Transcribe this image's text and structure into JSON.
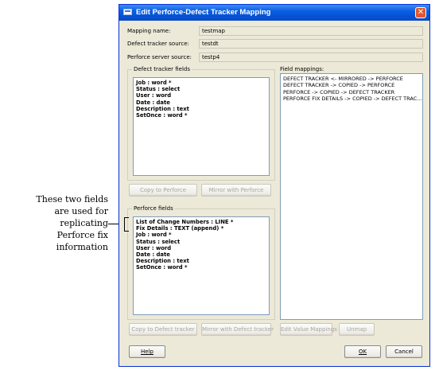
{
  "annotation": {
    "lines": [
      "These two fields",
      "are used for",
      "replicating",
      "Perforce fix",
      "information"
    ]
  },
  "window": {
    "title": "Edit Perforce-Defect Tracker Mapping",
    "close_glyph": "✕"
  },
  "form": {
    "mapping_name_label": "Mapping name:",
    "mapping_name_value": "testmap",
    "defect_source_label": "Defect tracker source:",
    "defect_source_value": "testdt",
    "perforce_source_label": "Perforce server source:",
    "perforce_source_value": "testp4"
  },
  "defect_fields": {
    "title": "Defect tracker fields",
    "items": [
      "Job : word *",
      "Status : select",
      "User : word",
      "Date : date",
      "Description : text",
      "SetOnce : word *"
    ],
    "copy_button": "Copy to Perforce",
    "mirror_button": "Mirror with Perforce"
  },
  "perforce_fields": {
    "title": "Perforce fields",
    "items": [
      "List of Change Numbers : LINE *",
      "Fix Details : TEXT (append) *",
      "Job : word *",
      "Status : select",
      "User : word",
      "Date : date",
      "Description : text",
      "SetOnce : word *"
    ],
    "copy_button": "Copy to Defect tracker",
    "mirror_button": "Mirror with Defect tracker"
  },
  "field_mappings": {
    "title": "Field mappings:",
    "items": [
      "DEFECT TRACKER <- MIRRORED -> PERFORCE",
      "DEFECT TRACKER -> COPIED -> PERFORCE",
      "PERFORCE -> COPIED -> DEFECT TRACKER",
      "PERFORCE FIX DETAILS -> COPIED -> DEFECT TRAC..."
    ],
    "edit_value_button": "Edit Value Mappings",
    "unmap_button": "Unmap"
  },
  "footer": {
    "help_button": "Help",
    "ok_button": "OK",
    "cancel_button": "Cancel"
  }
}
